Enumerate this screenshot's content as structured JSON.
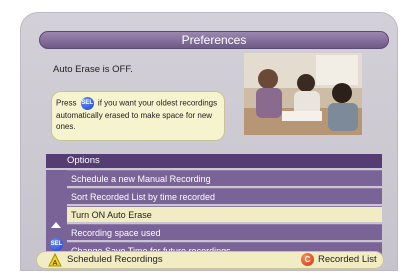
{
  "title": "Preferences",
  "status": "Auto Erase is OFF.",
  "hint": {
    "before": "Press",
    "button": "SEL",
    "after": "if you want your oldest recordings automatically erased to make space for new ones."
  },
  "options": {
    "header": "Options",
    "items": [
      "Schedule a new Manual Recording",
      "Sort Recorded List by time recorded",
      "Turn ON Auto Erase",
      "Recording space used",
      "Change Save Time for future recordings"
    ],
    "selected_index": 2,
    "nav_button": "SEL"
  },
  "bottom": {
    "left_key": "A",
    "left_label": "Scheduled Recordings",
    "right_key": "C",
    "right_label": "Recorded List"
  },
  "colors": {
    "header_purple": "#553d73",
    "row_purple": "#7a6396",
    "selected_row": "#f1ecc4",
    "panel": "#c6c3cc"
  }
}
